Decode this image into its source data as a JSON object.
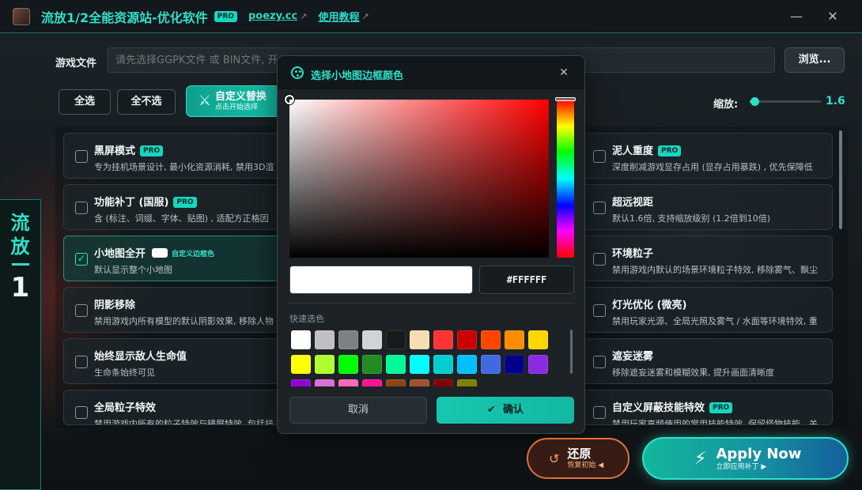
{
  "app": {
    "title": "流放1/2全能资源站-优化软件",
    "pro": "PRO",
    "link1": "poezy.cc",
    "link2": "使用教程"
  },
  "banner": {
    "c1": "流",
    "c2": "放",
    "num": "1"
  },
  "file": {
    "label": "游戏文件",
    "placeholder": "请先选择GGPK文件 或 BIN文件, 开",
    "browse": "浏览..."
  },
  "toolbar": {
    "select_all": "全选",
    "select_none": "全不选",
    "custom_replace": "自定义替换",
    "custom_replace_sub": "点击开始选择"
  },
  "zoom": {
    "label": "缩放:",
    "value": "1.6",
    "level": 0.067
  },
  "left_cards": [
    {
      "title": "黑屏模式",
      "pro": "PRO",
      "desc": "专为挂机场景设计, 最小化资源消耗, 禁用3D渲",
      "checked": false
    },
    {
      "title": "功能补丁 (国服)",
      "pro": "PRO",
      "desc": "含 (标注、词缀、字体、贴图) , 适配方正格因",
      "checked": false
    },
    {
      "title": "小地图全开",
      "extra": "自定义边框色",
      "desc": "默认显示整个小地图",
      "checked": true
    },
    {
      "title": "阴影移除",
      "desc": "禁用游戏内所有模型的默认阴影效果, 移除人物",
      "checked": false
    },
    {
      "title": "始终显示敌人生命值",
      "desc": "生命条始终可见",
      "checked": false
    },
    {
      "title": "全局粒子特效",
      "desc": "禁用游戏内所有的粒子特效与镜屏特效, 包括技",
      "checked": false
    }
  ],
  "right_cards": [
    {
      "title": "泥人重度",
      "pro": "PRO",
      "desc": "深度削减游戏显存占用 (显存占用暴跌) , 优先保障低",
      "checked": false
    },
    {
      "title": "超远视距",
      "desc": "默认1.6倍, 支持缩放级别 (1.2倍到10倍)",
      "checked": false
    },
    {
      "title": "环境粒子",
      "desc": "禁用游戏内默认的场景环境粒子特效, 移除雾气、飘尘",
      "checked": false
    },
    {
      "title": "灯光优化 (微亮)",
      "desc": "禁用玩家光源、全局光照及雾气 / 水面等环境特效, 重",
      "checked": false
    },
    {
      "title": "遮妄迷雾",
      "desc": "移除遮妄迷雾和模糊效果, 提升画面清晰度",
      "checked": false
    },
    {
      "title": "自定义屏蔽技能特效",
      "pro": "PRO",
      "desc": "禁用玩家高频使用的常用技能特效, 保留怪物技能、关",
      "checked": false
    }
  ],
  "dialog": {
    "title": "选择小地图边框颜色",
    "hex": "#FFFFFF",
    "quick_label": "快速选色",
    "cancel": "取消",
    "confirm": "确认",
    "swatches": [
      "#ffffff",
      "#c0c0c0",
      "#808080",
      "#d3d3d3",
      "#1a1a1a",
      "#f5deb3",
      "#ff3333",
      "#cc0000",
      "#ff4500",
      "#ff8c00",
      "#ffd700",
      "#ffff00",
      "#adff2f",
      "#00ff00",
      "#228b22",
      "#00fa9a",
      "#00ffff",
      "#00ced1",
      "#00bfff",
      "#4169e1",
      "#00008b",
      "#8a2be2",
      "#9400d3",
      "#da70d6",
      "#ff69b4",
      "#ff1493",
      "#8b4513",
      "#a0522d",
      "#800000",
      "#808000"
    ]
  },
  "actions": {
    "restore": "还原",
    "restore_sub": "恢复初始 ◀",
    "apply": "Apply Now",
    "apply_sub": "立即应用补丁 ▶"
  }
}
